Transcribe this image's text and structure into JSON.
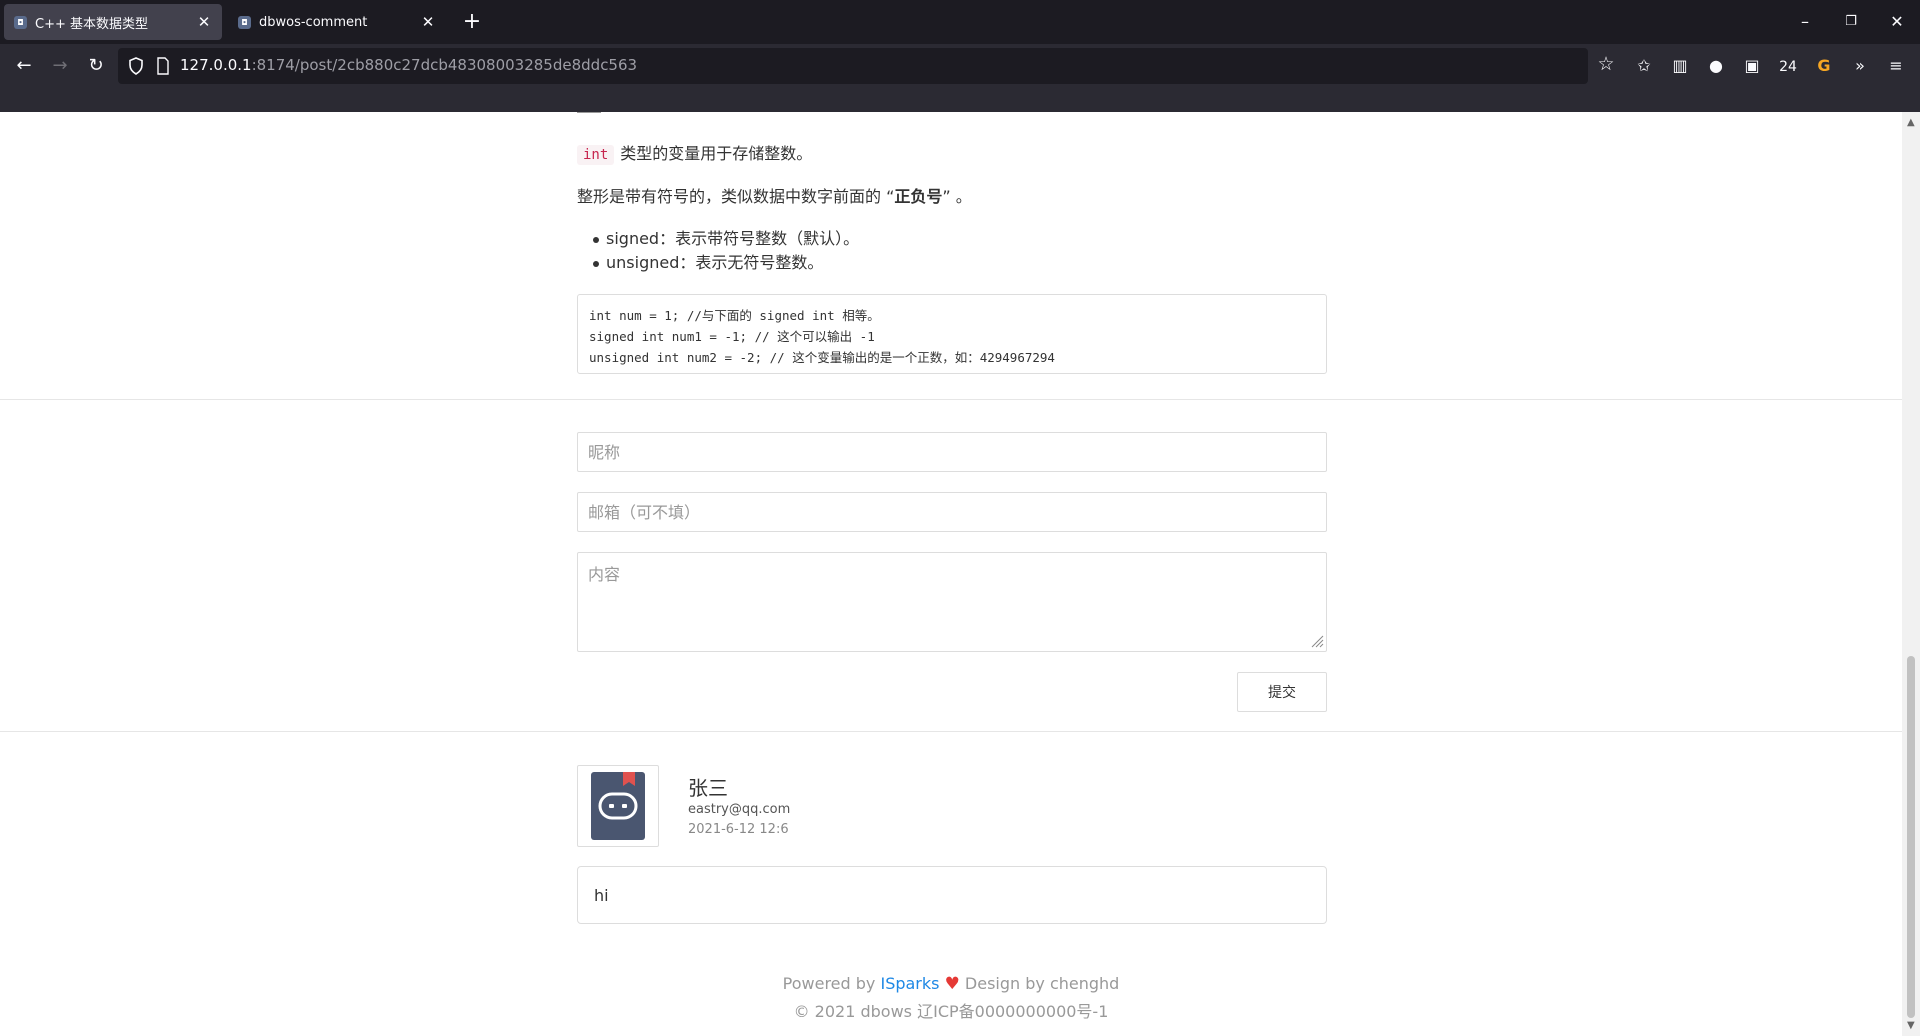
{
  "browser": {
    "tabs": [
      {
        "title": "C++ 基本数据类型",
        "active": true
      },
      {
        "title": "dbwos-comment",
        "active": false
      }
    ],
    "new_tab_icon": "plus-icon",
    "url_host": "127.0.0.1",
    "url_rest": ":8174/post/2cb880c27dcb48308003285de8ddc563",
    "toolbar_badge": "24",
    "colors": {
      "tabbar": "#1c1b22",
      "navbar": "#2b2a33",
      "active_tab": "#42414d",
      "accent": "#f6a623"
    }
  },
  "article": {
    "inline_code": "int",
    "intro_text": "类型的变量用于存储整数。",
    "signed_text_before": "整形是带有符号的，类似数据中数字前面的 “",
    "signed_text_bold": "正负号",
    "signed_text_after": "” 。",
    "bullets": [
      "signed：表示带符号整数（默认）。",
      "unsigned：表示无符号整数。"
    ],
    "code_lines": [
      "int num = 1; //与下面的 signed int 相等。",
      "signed int num1 = -1; // 这个可以输出 -1",
      "unsigned int num2 = -2; // 这个变量输出的是一个正数，如：4294967294"
    ]
  },
  "comment_form": {
    "nickname_placeholder": "昵称",
    "email_placeholder": "邮箱（可不填）",
    "content_placeholder": "内容",
    "submit_label": "提交"
  },
  "comments": [
    {
      "name": "张三",
      "email": "eastry@qq.com",
      "date": "2021-6-12 12:6",
      "content": "hi"
    }
  ],
  "footer": {
    "powered_by": "Powered by",
    "brand": "ISparks",
    "design_by": "Design by chenghd",
    "copyright": "© 2021 dbows 辽ICP备0000000000号-1",
    "brand_color": "#1e88e5",
    "heart_color": "#e53935"
  }
}
